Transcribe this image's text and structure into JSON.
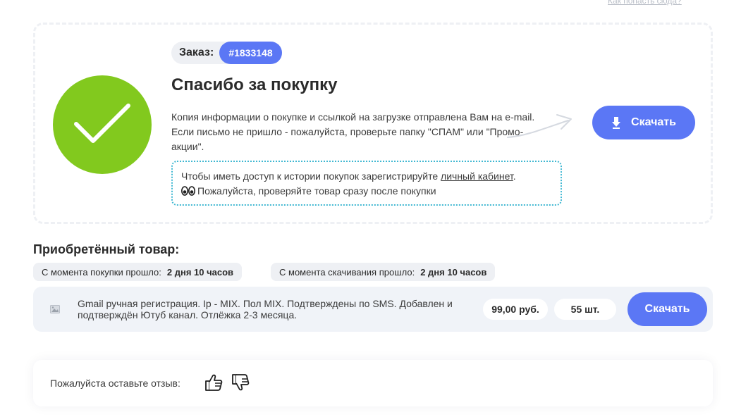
{
  "header": {
    "help_link": "Как попасть сюда?"
  },
  "order": {
    "label": "Заказ:",
    "number": "#1833148",
    "title": "Спасибо за покупку",
    "info_line1": "Копия информации о покупке и ссылкой на загрузке отправлена Вам на e-mail.",
    "info_line2": "Если письмо не пришло - пожалуйста, проверьте папку \"СПАМ\" или \"Промо-",
    "info_line3": "акции\".",
    "download_label": "Скачать",
    "note_text1": "Чтобы иметь доступ к истории покупок зарегистрируйте ",
    "note_link": "личный кабинет",
    "note_text1_end": ".",
    "note_text2": "Пожалуйста, проверяйте товар сразу после покупки"
  },
  "purchased": {
    "title": "Приобретённый товар:",
    "since_purchase_label": "С момента покупки прошло:",
    "since_purchase_value": "2 дня 10 часов",
    "since_download_label": "С момента скачивания прошло:",
    "since_download_value": "2 дня 10 часов",
    "product": {
      "title": "Gmail ручная регистрация. Ip - MIX. Пол MIX. Подтверждены по SMS. Добавлен и подтверждён Ютуб канал. Отлёжка 2-3 месяца.",
      "price": "99,00 руб.",
      "quantity": "55 шт.",
      "download_label": "Скачать"
    }
  },
  "review": {
    "label": "Пожалуйста оставьте отзыв:"
  },
  "colors": {
    "accent": "#5b77f5",
    "success": "#82c91e",
    "note_border": "#41b8d2"
  },
  "icons": [
    "check-icon",
    "download-icon",
    "eyes-icon",
    "image-placeholder-icon",
    "thumbs-up-icon",
    "thumbs-down-icon"
  ]
}
